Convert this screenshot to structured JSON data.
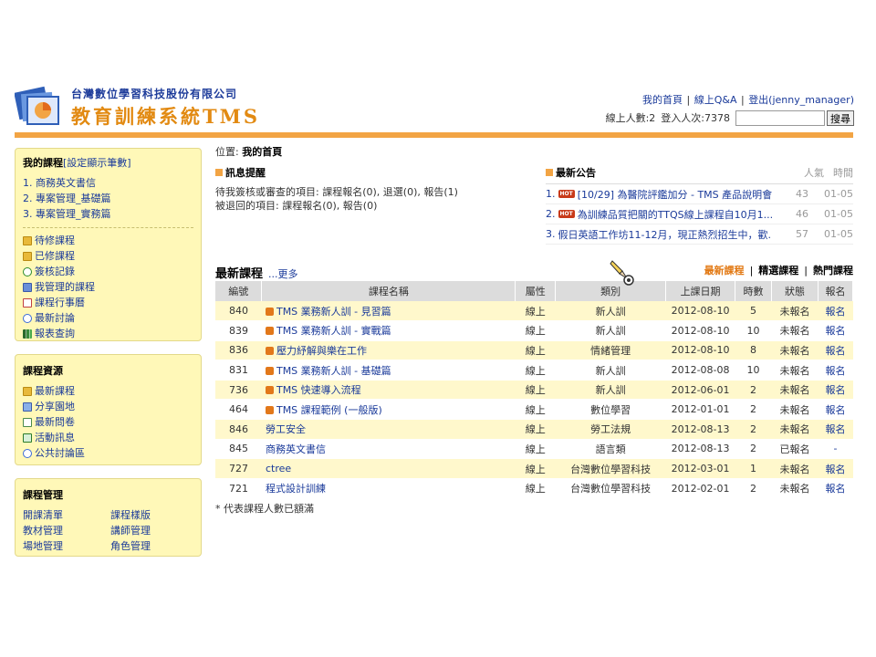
{
  "header": {
    "company": "台灣數位學習科技股份有限公司",
    "system": "教育訓練系統TMS",
    "links": [
      "我的首頁",
      "線上Q&A",
      "登出(jenny_manager)"
    ],
    "online_text": "線上人數:2",
    "login_text": "登入人次:7378",
    "search_value": "",
    "search_button": "搜尋"
  },
  "sidebar": {
    "my_courses": {
      "title": "我的課程",
      "setting": "[設定顯示筆數]",
      "courses": [
        "1. 商務英文書信",
        "2. 專案管理_基礎篇",
        "3. 專案管理_實務篇"
      ],
      "links": [
        {
          "label": "待修課程",
          "icon": "folder-icon"
        },
        {
          "label": "已修課程",
          "icon": "folder-icon"
        },
        {
          "label": "簽核記錄",
          "icon": "check-icon"
        },
        {
          "label": "我管理的課程",
          "icon": "pencil-icon"
        },
        {
          "label": "課程行事曆",
          "icon": "calendar-icon"
        },
        {
          "label": "最新討論",
          "icon": "bubble-icon"
        },
        {
          "label": "報表查詢",
          "icon": "chart-icon"
        }
      ]
    },
    "resources": {
      "title": "課程資源",
      "links": [
        {
          "label": "最新課程",
          "icon": "folder-icon"
        },
        {
          "label": "分享園地",
          "icon": "share-icon"
        },
        {
          "label": "最新問卷",
          "icon": "doc-icon"
        },
        {
          "label": "活動訊息",
          "icon": "news-icon"
        },
        {
          "label": "公共討論區",
          "icon": "bubble-icon"
        }
      ]
    },
    "management": {
      "title": "課程管理",
      "links": [
        "開課清單",
        "課程樣版",
        "教材管理",
        "講師管理",
        "場地管理",
        "角色管理"
      ]
    }
  },
  "breadcrumb": {
    "label": "位置:",
    "current": "我的首頁"
  },
  "notice": {
    "title": "訊息提醒",
    "lines": [
      "待我簽核或審查的項目: 課程報名(0), 退選(0), 報告(1)",
      "被退回的項目: 課程報名(0), 報告(0)"
    ]
  },
  "news": {
    "title": "最新公告",
    "col_popularity": "人氣",
    "col_time": "時間",
    "items": [
      {
        "num": "1.",
        "hot": true,
        "title": "[10/29] 為醫院評鑑加分 - TMS 產品說明會",
        "views": "43",
        "date": "01-05"
      },
      {
        "num": "2.",
        "hot": true,
        "title": "為訓練品質把關的TTQS線上課程自10月1...",
        "views": "46",
        "date": "01-05"
      },
      {
        "num": "3.",
        "hot": false,
        "title": "假日英語工作坊11-12月，現正熱烈招生中，歡...",
        "views": "57",
        "date": "01-05"
      }
    ],
    "hot_label": "HOT"
  },
  "courses": {
    "title": "最新課程",
    "more": "...更多",
    "tabs": [
      "最新課程",
      "精選課程",
      "熱門課程"
    ],
    "columns": [
      "編號",
      "課程名稱",
      "屬性",
      "類別",
      "上課日期",
      "時數",
      "狀態",
      "報名"
    ],
    "rows": [
      {
        "id": "840",
        "icon": true,
        "name": "TMS 業務新人訓 - 見習篇",
        "attr": "線上",
        "category": "新人訓",
        "date": "2012-08-10",
        "hours": "5",
        "status": "未報名",
        "signup": "報名"
      },
      {
        "id": "839",
        "icon": true,
        "name": "TMS 業務新人訓 - 實戰篇",
        "attr": "線上",
        "category": "新人訓",
        "date": "2012-08-10",
        "hours": "10",
        "status": "未報名",
        "signup": "報名"
      },
      {
        "id": "836",
        "icon": true,
        "name": "壓力紓解與樂在工作",
        "attr": "線上",
        "category": "情緒管理",
        "date": "2012-08-10",
        "hours": "8",
        "status": "未報名",
        "signup": "報名"
      },
      {
        "id": "831",
        "icon": true,
        "name": "TMS 業務新人訓 - 基礎篇",
        "attr": "線上",
        "category": "新人訓",
        "date": "2012-08-08",
        "hours": "10",
        "status": "未報名",
        "signup": "報名"
      },
      {
        "id": "736",
        "icon": true,
        "name": "TMS 快速導入流程",
        "attr": "線上",
        "category": "新人訓",
        "date": "2012-06-01",
        "hours": "2",
        "status": "未報名",
        "signup": "報名"
      },
      {
        "id": "464",
        "icon": true,
        "name": "TMS 課程範例 (一般版)",
        "attr": "線上",
        "category": "數位學習",
        "date": "2012-01-01",
        "hours": "2",
        "status": "未報名",
        "signup": "報名"
      },
      {
        "id": "846",
        "icon": false,
        "name": "勞工安全",
        "attr": "線上",
        "category": "勞工法規",
        "date": "2012-08-13",
        "hours": "2",
        "status": "未報名",
        "signup": "報名"
      },
      {
        "id": "845",
        "icon": false,
        "name": "商務英文書信",
        "attr": "線上",
        "category": "語言類",
        "date": "2012-08-13",
        "hours": "2",
        "status": "已報名",
        "signup": "-"
      },
      {
        "id": "727",
        "icon": false,
        "name": "ctree",
        "attr": "線上",
        "category": "台灣數位學習科技",
        "date": "2012-03-01",
        "hours": "1",
        "status": "未報名",
        "signup": "報名"
      },
      {
        "id": "721",
        "icon": false,
        "name": "程式設計訓練",
        "attr": "線上",
        "category": "台灣數位學習科技",
        "date": "2012-02-01",
        "hours": "2",
        "status": "未報名",
        "signup": "報名"
      }
    ],
    "footnote": "* 代表課程人數已額滿"
  },
  "colors": {
    "accent": "#f2a444",
    "link": "#1a3a9a",
    "sidebar_bg": "#fff8b8",
    "row_alt": "#fff8cc"
  }
}
